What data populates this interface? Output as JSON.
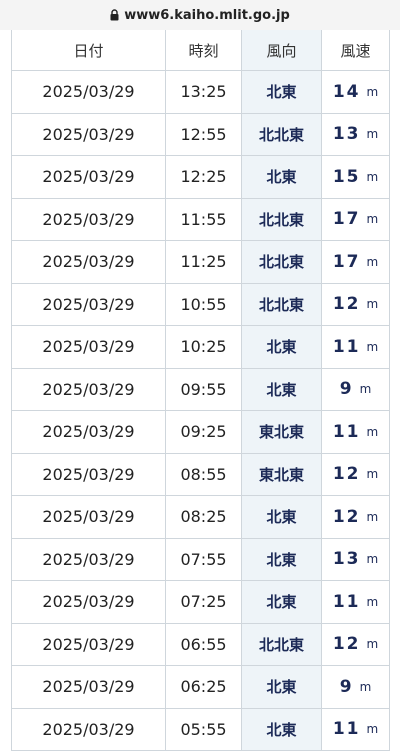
{
  "browser": {
    "url": "www6.kaiho.mlit.go.jp"
  },
  "table": {
    "headers": {
      "date": "日付",
      "time": "時刻",
      "direction": "風向",
      "speed": "風速"
    },
    "unit": "m",
    "rows": [
      {
        "date": "2025/03/29",
        "time": "13:25",
        "direction": "北東",
        "speed": "14"
      },
      {
        "date": "2025/03/29",
        "time": "12:55",
        "direction": "北北東",
        "speed": "13"
      },
      {
        "date": "2025/03/29",
        "time": "12:25",
        "direction": "北東",
        "speed": "15"
      },
      {
        "date": "2025/03/29",
        "time": "11:55",
        "direction": "北北東",
        "speed": "17"
      },
      {
        "date": "2025/03/29",
        "time": "11:25",
        "direction": "北北東",
        "speed": "17"
      },
      {
        "date": "2025/03/29",
        "time": "10:55",
        "direction": "北北東",
        "speed": "12"
      },
      {
        "date": "2025/03/29",
        "time": "10:25",
        "direction": "北東",
        "speed": "11"
      },
      {
        "date": "2025/03/29",
        "time": "09:55",
        "direction": "北東",
        "speed": "9"
      },
      {
        "date": "2025/03/29",
        "time": "09:25",
        "direction": "東北東",
        "speed": "11"
      },
      {
        "date": "2025/03/29",
        "time": "08:55",
        "direction": "東北東",
        "speed": "12"
      },
      {
        "date": "2025/03/29",
        "time": "08:25",
        "direction": "北東",
        "speed": "12"
      },
      {
        "date": "2025/03/29",
        "time": "07:55",
        "direction": "北東",
        "speed": "13"
      },
      {
        "date": "2025/03/29",
        "time": "07:25",
        "direction": "北東",
        "speed": "11"
      },
      {
        "date": "2025/03/29",
        "time": "06:55",
        "direction": "北北東",
        "speed": "12"
      },
      {
        "date": "2025/03/29",
        "time": "06:25",
        "direction": "北東",
        "speed": "9"
      },
      {
        "date": "2025/03/29",
        "time": "05:55",
        "direction": "北東",
        "speed": "11"
      }
    ]
  }
}
